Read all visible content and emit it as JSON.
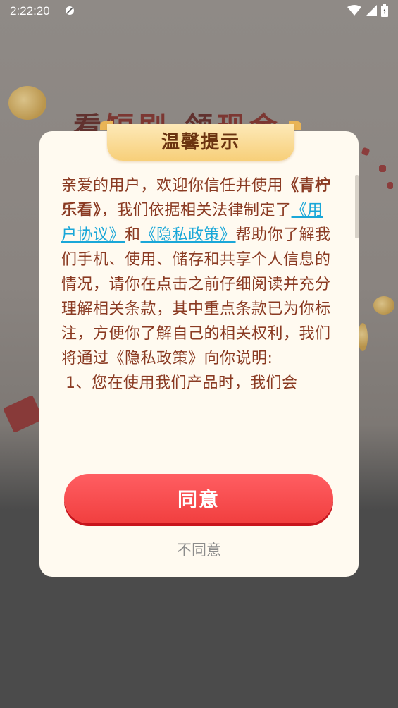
{
  "status_bar": {
    "time": "2:22:20"
  },
  "background": {
    "headline_part1": "看",
    "headline_part2": "短剧",
    "headline_part3": "领",
    "headline_part4": "现金"
  },
  "dialog": {
    "title": "温馨提示",
    "content": {
      "p1_prefix": "亲爱的用户，欢迎你信任并使用",
      "brand": "《青柠乐看》",
      "p1_mid": "，我们依据相关法律制定了",
      "link_user_agreement": "《用户协议》",
      "and_text": "和",
      "link_privacy_policy": "《隐私政策》",
      "p1_suffix": "帮助你了解我们手机、使用、储存和共享个人信息的情况，请你在点击之前仔细阅读并充分理解相关条款，其中重点条款已为你标注，方便你了解自己的相关权利，我们将通过《隐私政策》向你说明:",
      "item1": "1、您在使用我们产品时，我们会"
    },
    "agree_label": "同意",
    "disagree_label": "不同意"
  }
}
